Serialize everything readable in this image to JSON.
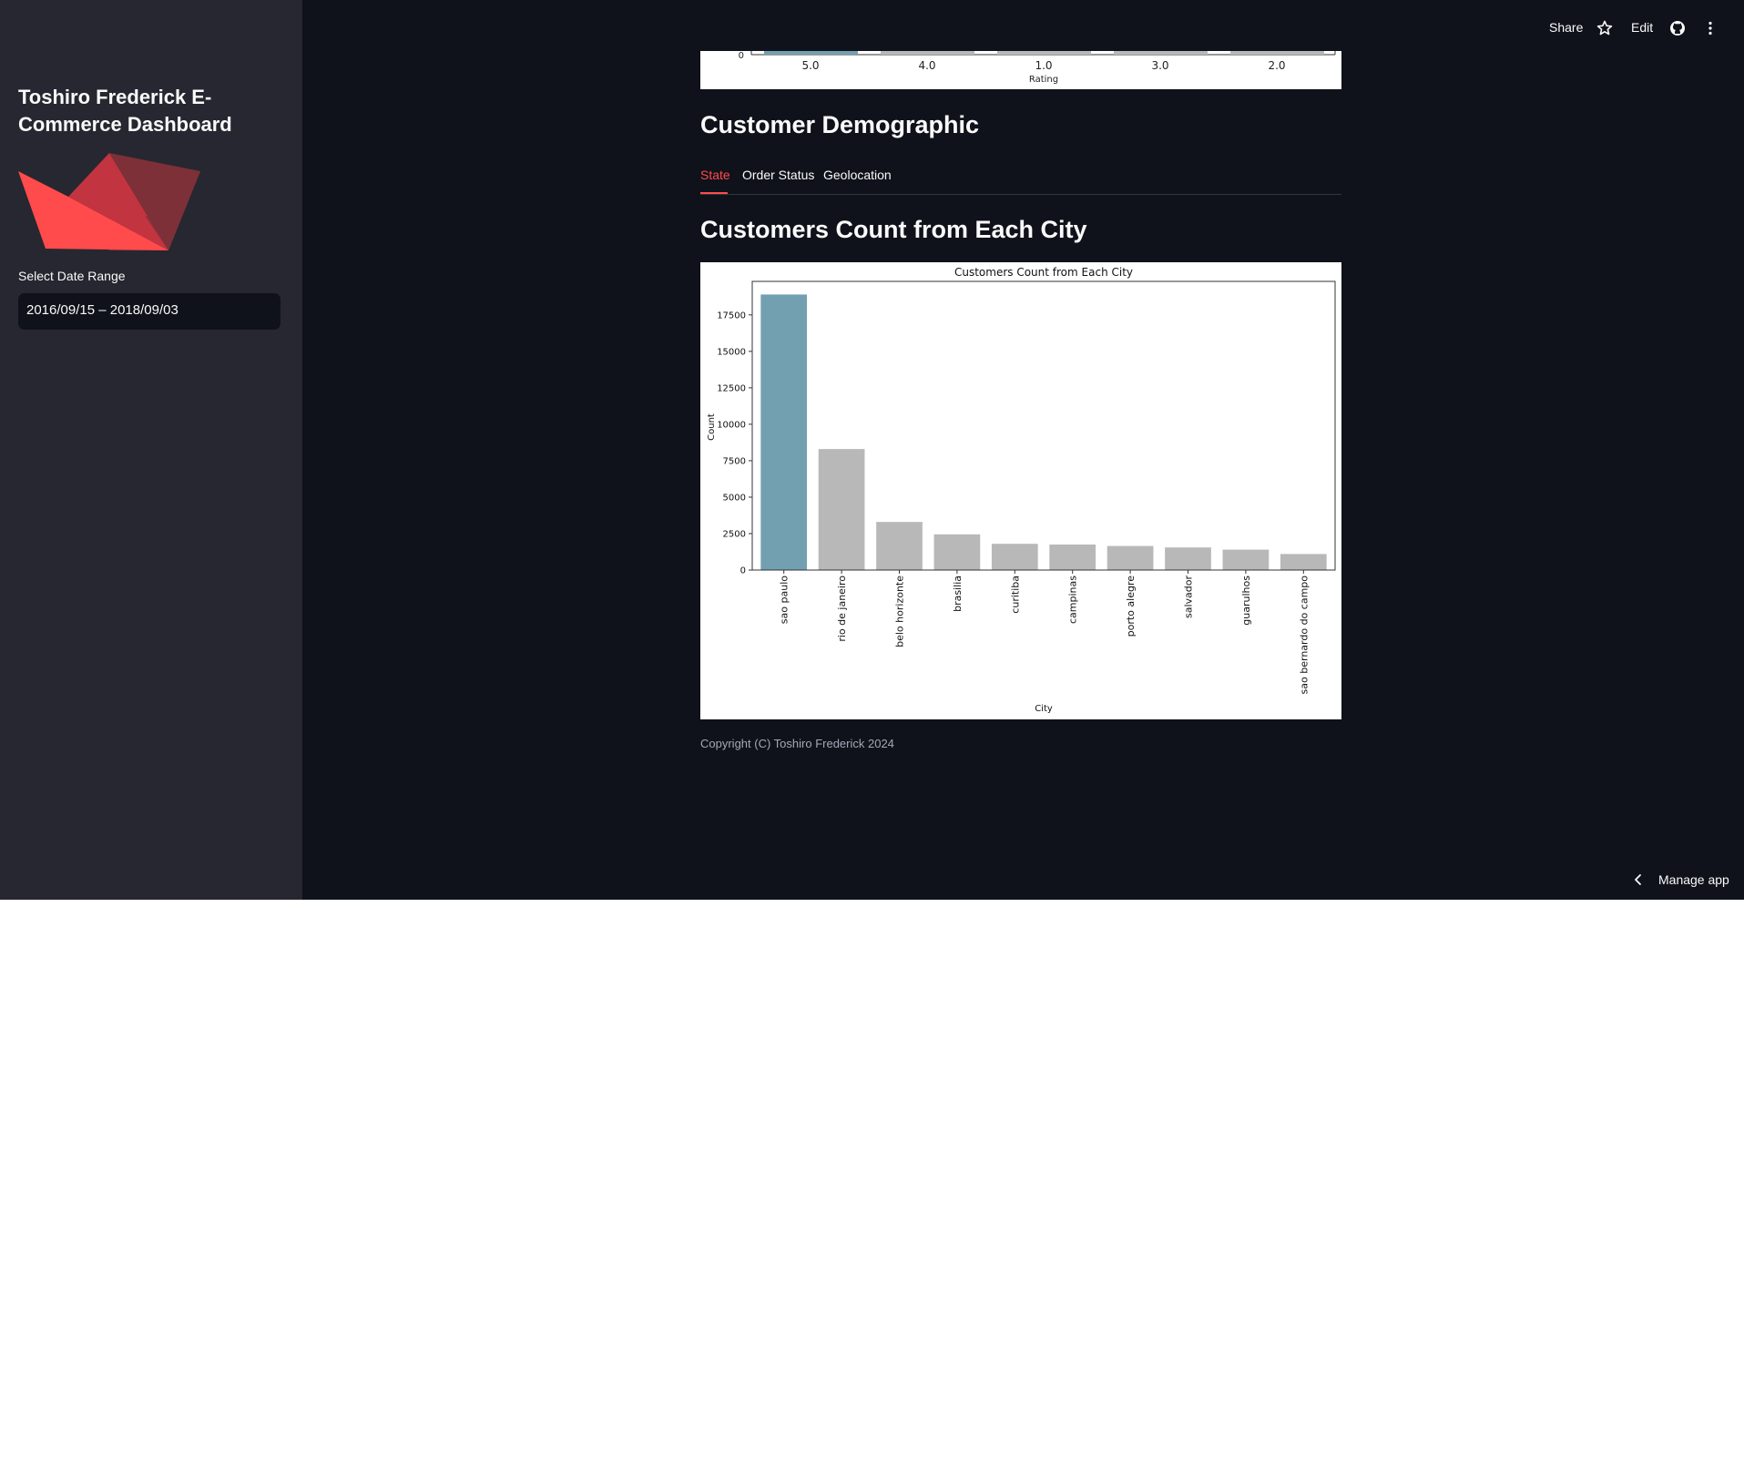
{
  "sidebar": {
    "title": "Toshiro Frederick E-Commerce Dashboard",
    "logo_icon": "streamlit-boat-logo",
    "date_range_label": "Select Date Range",
    "date_range_value": "2016/09/15 – 2018/09/03"
  },
  "toolbar": {
    "share_label": "Share",
    "edit_label": "Edit",
    "icons": [
      "star-icon",
      "github-icon",
      "more-vertical-icon"
    ]
  },
  "rating_chart": {
    "y_tick_zero": "0",
    "categories": [
      "5.0",
      "4.0",
      "1.0",
      "3.0",
      "2.0"
    ],
    "xlabel": "Rating"
  },
  "section": {
    "heading": "Customer Demographic",
    "tabs": [
      "State",
      "Order Status",
      "Geolocation"
    ],
    "active_tab": "State"
  },
  "chart_heading": "Customers Count from Each City",
  "chart_data": {
    "type": "bar",
    "title": "Customers Count from Each City",
    "xlabel": "City",
    "ylabel": "Count",
    "categories": [
      "sao paulo",
      "rio de janeiro",
      "belo horizonte",
      "brasilia",
      "curitiba",
      "campinas",
      "porto alegre",
      "salvador",
      "guarulhos",
      "sao bernardo do campo"
    ],
    "values": [
      18900,
      8300,
      3300,
      2450,
      1800,
      1750,
      1650,
      1550,
      1400,
      1100
    ],
    "ylim": [
      0,
      19800
    ],
    "yticks": [
      0,
      2500,
      5000,
      7500,
      10000,
      12500,
      15000,
      17500
    ],
    "highlight_color": "#72a0b1",
    "bar_color": "#b8b8b8",
    "grid": false
  },
  "footer": {
    "copyright": "Copyright (C) Toshiro Frederick 2024",
    "manage_app": "Manage app"
  },
  "colors": {
    "background": "#0f121a",
    "sidebar": "#262730",
    "accent": "#ff4b4b",
    "text": "#fafafa"
  }
}
